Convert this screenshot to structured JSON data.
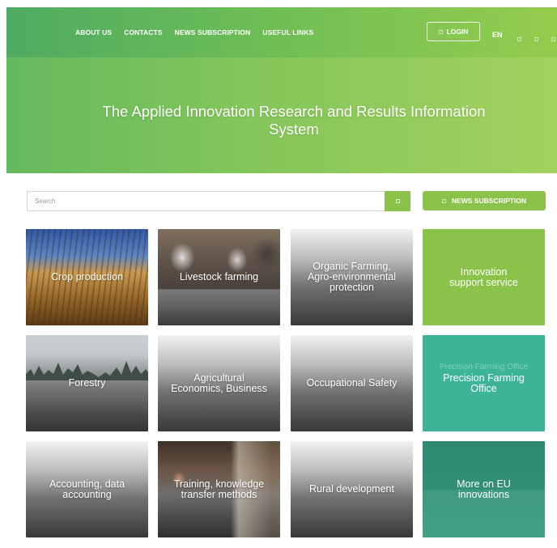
{
  "header": {
    "nav": [
      "ABOUT US",
      "CONTACTS",
      "NEWS SUBSCRIPTION",
      "USEFUL LINKS"
    ],
    "login_label": "LOGIN",
    "language": "EN",
    "social_icons": [
      "social-icon-1",
      "social-icon-2",
      "social-icon-3"
    ]
  },
  "hero": {
    "title": "The Applied Innovation Research and Results Information System"
  },
  "search": {
    "placeholder": "Search",
    "button_icon": "search-icon"
  },
  "news_button": {
    "label": "NEWS SUBSCRIPTION"
  },
  "tiles": [
    "Crop production",
    "Livestock farming",
    "Organic Farming, Agro-environmental protection",
    "Innovation support service",
    "Forestry",
    "Agricultural Economics, Business",
    "Occupational Safety",
    "Precision Farming Office",
    "Accounting, data accounting",
    "Training, knowledge transfer methods",
    "Rural development",
    "More on EU innovations"
  ],
  "colors": {
    "brand_green": "#8bc34a",
    "header_green": "#4fab62",
    "teal": "#3db497",
    "dark_teal": "#2e8a70"
  }
}
